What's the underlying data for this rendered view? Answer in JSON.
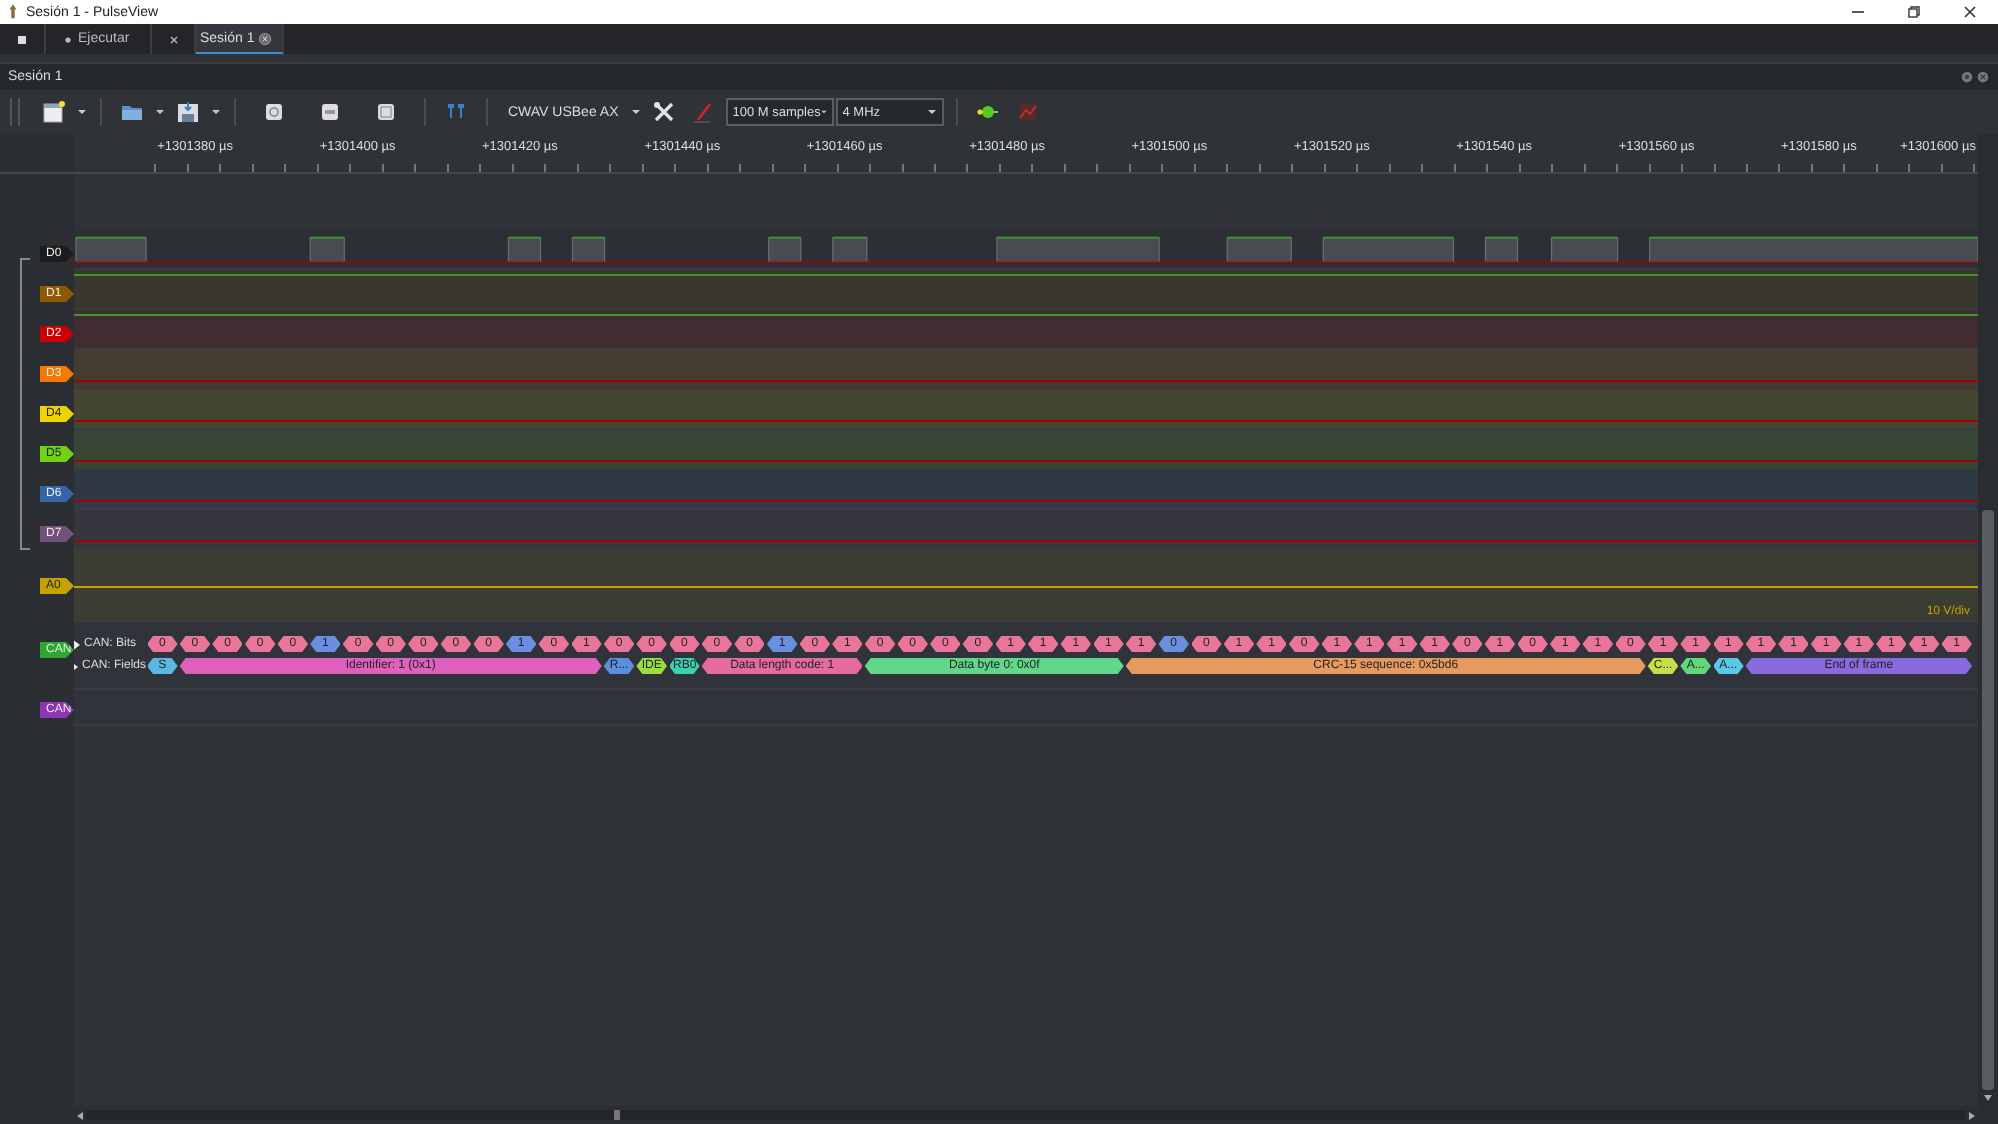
{
  "window": {
    "title": "Sesión 1 - PulseView"
  },
  "tabs": [
    {
      "kind": "stop",
      "selected": false
    },
    {
      "kind": "run",
      "label": "Ejecutar",
      "selected": false
    },
    {
      "kind": "tool",
      "selected": false
    },
    {
      "kind": "session",
      "label": "Sesión 1",
      "selected": true
    }
  ],
  "dock": {
    "title": "Sesión 1"
  },
  "toolbar": {
    "device": "CWAV USBee AX",
    "samples": "100 M samples",
    "rate": "4 MHz"
  },
  "ruler": {
    "ticks": [
      "+1301380 µs",
      "+1301400 µs",
      "+1301420 µs",
      "+1301440 µs",
      "+1301460 µs",
      "+1301480 µs",
      "+1301500 µs",
      "+1301520 µs",
      "+1301540 µs",
      "+1301560 µs",
      "+1301580 µs",
      "+1301600 µs"
    ]
  },
  "channels": [
    {
      "name": "D0",
      "kind": "pulses",
      "color": "#1c1c1c"
    },
    {
      "name": "D1",
      "kind": "logic",
      "color": "#8f5902",
      "high": true
    },
    {
      "name": "D2",
      "kind": "logic",
      "color": "#cc0000",
      "high": true
    },
    {
      "name": "D3",
      "kind": "logic",
      "color": "#f57900",
      "high": false
    },
    {
      "name": "D4",
      "kind": "logic",
      "color": "#edd400",
      "high": false
    },
    {
      "name": "D5",
      "kind": "logic",
      "color": "#73d216",
      "high": false
    },
    {
      "name": "D6",
      "kind": "logic",
      "color": "#3465a4",
      "high": false
    },
    {
      "name": "D7",
      "kind": "logic",
      "color": "#75507b",
      "high": false
    },
    {
      "name": "A0",
      "kind": "analog",
      "color": "#c4a000",
      "scale": "10 V/div"
    },
    {
      "name": "CAN",
      "kind": "decoder",
      "color": "#2ea82e",
      "bits_label": "CAN: Bits",
      "fields_label": "CAN: Fields",
      "fields": [
        {
          "label": "S",
          "color": "#5bb8e0",
          "bits": [
            {
              "value": "0",
              "stuffed": false
            }
          ]
        },
        {
          "label": "Identifier: 1 (0x1)",
          "color": "#e060c0",
          "bits": [
            {
              "value": "0",
              "stuffed": false
            },
            {
              "value": "0",
              "stuffed": false
            },
            {
              "value": "0",
              "stuffed": false
            },
            {
              "value": "0",
              "stuffed": false
            },
            {
              "value": "1",
              "stuffed": true
            },
            {
              "value": "0",
              "stuffed": false
            },
            {
              "value": "0",
              "stuffed": false
            },
            {
              "value": "0",
              "stuffed": false
            },
            {
              "value": "0",
              "stuffed": false
            },
            {
              "value": "0",
              "stuffed": false
            },
            {
              "value": "1",
              "stuffed": true
            },
            {
              "value": "0",
              "stuffed": false
            },
            {
              "value": "1",
              "stuffed": false
            }
          ]
        },
        {
          "label": "R...",
          "color": "#5a8fe0",
          "bits": [
            {
              "value": "0",
              "stuffed": false
            }
          ]
        },
        {
          "label": "IDE",
          "color": "#9be03a",
          "bits": [
            {
              "value": "0",
              "stuffed": false
            }
          ]
        },
        {
          "label": "RB0",
          "color": "#3ad0b0",
          "bits": [
            {
              "value": "0",
              "stuffed": false
            }
          ]
        },
        {
          "label": "Data length code: 1",
          "color": "#e56a9e",
          "bits": [
            {
              "value": "0",
              "stuffed": false
            },
            {
              "value": "0",
              "stuffed": false
            },
            {
              "value": "1",
              "stuffed": true
            },
            {
              "value": "0",
              "stuffed": false
            },
            {
              "value": "1",
              "stuffed": false
            }
          ]
        },
        {
          "label": "Data byte 0: 0x0f",
          "color": "#5fd88a",
          "bits": [
            {
              "value": "0",
              "stuffed": false
            },
            {
              "value": "0",
              "stuffed": false
            },
            {
              "value": "0",
              "stuffed": false
            },
            {
              "value": "0",
              "stuffed": false
            },
            {
              "value": "1",
              "stuffed": false
            },
            {
              "value": "1",
              "stuffed": false
            },
            {
              "value": "1",
              "stuffed": false
            },
            {
              "value": "1",
              "stuffed": false
            }
          ]
        },
        {
          "label": "CRC-15 sequence: 0x5bd6",
          "color": "#e89a5e",
          "bits": [
            {
              "value": "1",
              "stuffed": false
            },
            {
              "value": "0",
              "stuffed": true
            },
            {
              "value": "0",
              "stuffed": false
            },
            {
              "value": "1",
              "stuffed": false
            },
            {
              "value": "1",
              "stuffed": false
            },
            {
              "value": "0",
              "stuffed": false
            },
            {
              "value": "1",
              "stuffed": false
            },
            {
              "value": "1",
              "stuffed": false
            },
            {
              "value": "1",
              "stuffed": false
            },
            {
              "value": "1",
              "stuffed": false
            },
            {
              "value": "0",
              "stuffed": false
            },
            {
              "value": "1",
              "stuffed": false
            },
            {
              "value": "0",
              "stuffed": false
            },
            {
              "value": "1",
              "stuffed": false
            },
            {
              "value": "1",
              "stuffed": false
            },
            {
              "value": "0",
              "stuffed": false
            }
          ]
        },
        {
          "label": "C...",
          "color": "#c8e048",
          "bits": [
            {
              "value": "1",
              "stuffed": false
            }
          ]
        },
        {
          "label": "A...",
          "color": "#5fd87a",
          "bits": [
            {
              "value": "1",
              "stuffed": false
            }
          ]
        },
        {
          "label": "A...",
          "color": "#5ac8e8",
          "bits": [
            {
              "value": "1",
              "stuffed": false
            }
          ]
        },
        {
          "label": "End of frame",
          "color": "#8a6ae0",
          "bits": [
            {
              "value": "1",
              "stuffed": false
            },
            {
              "value": "1",
              "stuffed": false
            },
            {
              "value": "1",
              "stuffed": false
            },
            {
              "value": "1",
              "stuffed": false
            },
            {
              "value": "1",
              "stuffed": false
            },
            {
              "value": "1",
              "stuffed": false
            },
            {
              "value": "1",
              "stuffed": false
            }
          ]
        }
      ]
    },
    {
      "name": "CAN",
      "kind": "decoder",
      "color": "#8e35b5"
    }
  ]
}
